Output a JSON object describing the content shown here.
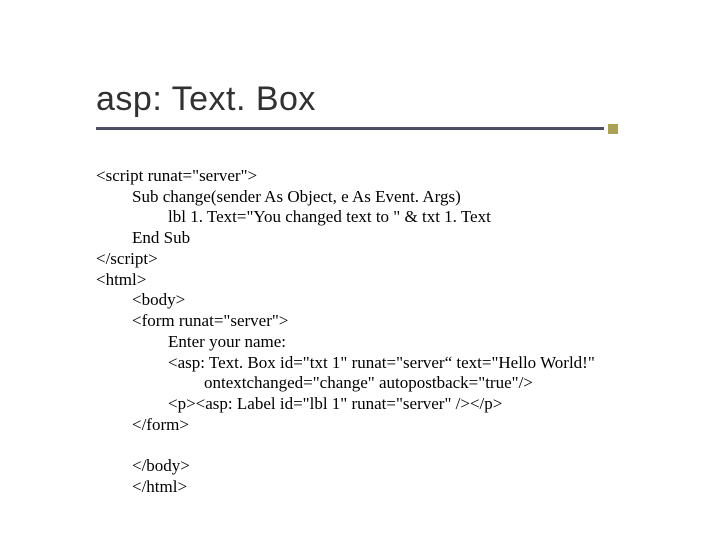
{
  "title": "asp: Text. Box",
  "code": {
    "l1": "<script runat=\"server\">",
    "l2": "Sub change(sender As Object, e As Event. Args)",
    "l3": "lbl 1. Text=\"You changed text to \" & txt 1. Text",
    "l4": "End Sub",
    "l5": "</script>",
    "l6": "<html>",
    "l7": "<body>",
    "l8": "<form runat=\"server\">",
    "l9": "Enter your name:",
    "l10": "<asp: Text. Box id=\"txt 1\" runat=\"server“ text=\"Hello World!\"",
    "l11": "ontextchanged=\"change\" autopostback=\"true\"/>",
    "l12": "<p><asp: Label id=\"lbl 1\" runat=\"server\" /></p>",
    "l13": "</form>",
    "l14": "</body>",
    "l15": "</html>"
  }
}
